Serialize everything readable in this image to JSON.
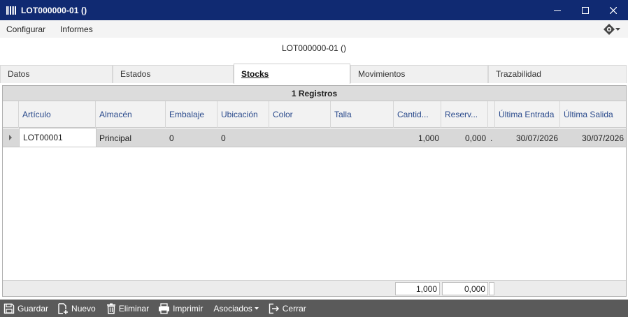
{
  "window": {
    "title": "LOT000000-01 ()"
  },
  "menu": {
    "items": [
      "Configurar",
      "Informes"
    ]
  },
  "form_title": "LOT000000-01 ()",
  "tabs": [
    {
      "label": "Datos",
      "active": false
    },
    {
      "label": "Estados",
      "active": false
    },
    {
      "label": "Stocks",
      "active": true
    },
    {
      "label": "Movimientos",
      "active": false
    },
    {
      "label": "Trazabilidad",
      "active": false
    }
  ],
  "grid": {
    "record_count": "1 Registros",
    "columns": [
      "Artículo",
      "Almacén",
      "Embalaje",
      "Ubicación",
      "Color",
      "Talla",
      "Cantid...",
      "Reserv...",
      "",
      "Última Entrada",
      "Última Salida"
    ],
    "rows": [
      [
        "LOT00001",
        "Principal",
        "0",
        "0",
        "",
        "",
        "1,000",
        "0,000",
        ".",
        "30/07/2026",
        "30/07/2026"
      ]
    ],
    "totals": {
      "cantidad": "1,000",
      "reservado": "0,000"
    }
  },
  "toolbar": {
    "save": "Guardar",
    "new": "Nuevo",
    "delete": "Eliminar",
    "print": "Imprimir",
    "associated": "Asociados",
    "close": "Cerrar"
  }
}
